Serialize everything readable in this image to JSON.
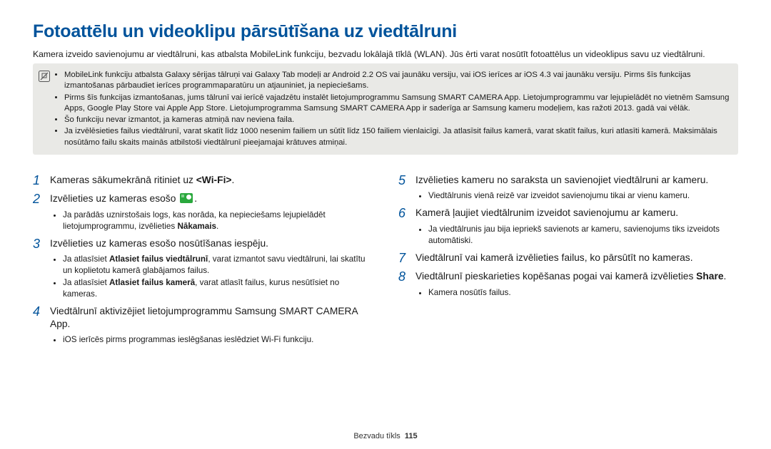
{
  "title": "Fotoattēlu un videoklipu pārsūtīšana uz viedtālruni",
  "intro": "Kamera izveido savienojumu ar viedtālruni, kas atbalsta MobileLink funkciju, bezvadu lokālajā tīklā (WLAN). Jūs ērti varat nosūtīt fotoattēlus un videoklipus savu uz viedtālruni.",
  "note": {
    "b1": "MobileLink funkciju atbalsta Galaxy sērijas tālruņi vai Galaxy Tab modeļi ar Android 2.2 OS vai jaunāku versiju, vai iOS ierīces ar iOS 4.3 vai jaunāku versiju. Pirms šīs funkcijas izmantošanas pārbaudiet ierīces programmaparatūru un atjauniniet, ja nepieciešams.",
    "b2": "Pirms šīs funkcijas izmantošanas, jums tālrunī vai ierīcē vajadzētu instalēt lietojumprogrammu Samsung SMART CAMERA App. Lietojumprogrammu var lejupielādēt no vietnēm Samsung Apps, Google Play Store vai Apple App Store. Lietojumprogramma Samsung SMART CAMERA App ir saderīga ar Samsung kameru modeļiem, kas ražoti 2013. gadā vai vēlāk.",
    "b3": "Šo funkciju nevar izmantot, ja kameras atmiņā nav neviena faila.",
    "b4": "Ja izvēlēsieties failus viedtālrunī, varat skatīt līdz 1000 nesenim failiem un sūtīt līdz 150 failiem vienlaicīgi. Ja atlasīsit failus kamerā, varat skatīt failus, kuri atlasīti kamerā. Maksimālais nosūtāmo failu skaits mainās atbilstoši viedtālrunī pieejamajai krātuves atmiņai."
  },
  "steps": {
    "s1": {
      "n": "1",
      "t_a": "Kameras sākumekrānā ritiniet uz ",
      "t_b": "<Wi-Fi>",
      "t_c": "."
    },
    "s2": {
      "n": "2",
      "t": "Izvēlieties uz kameras esošo ",
      "t2": ".",
      "sub_a": "Ja parādās uznirstošais logs, kas norāda, ka nepieciešams lejupielādēt lietojumprogrammu, izvēlieties ",
      "sub_b": "Nākamais",
      "sub_c": "."
    },
    "s3": {
      "n": "3",
      "t": "Izvēlieties uz kameras esošo nosūtīšanas iespēju.",
      "sub1_a": "Ja atlasīsiet ",
      "sub1_b": "Atlasiet failus viedtālrunī",
      "sub1_c": ", varat izmantot savu viedtālruni, lai skatītu un koplietotu kamerā glabājamos failus.",
      "sub2_a": "Ja atlasīsiet ",
      "sub2_b": "Atlasiet failus kamerā",
      "sub2_c": ", varat atlasīt failus, kurus nesūtīsiet no kameras."
    },
    "s4": {
      "n": "4",
      "t": "Viedtālrunī aktivizējiet lietojumprogrammu Samsung SMART CAMERA App.",
      "sub": "iOS ierīcēs pirms programmas ieslēgšanas ieslēdziet Wi-Fi funkciju."
    },
    "s5": {
      "n": "5",
      "t": "Izvēlieties kameru no saraksta un savienojiet viedtālruni ar kameru.",
      "sub": "Viedtālrunis vienā reizē var izveidot savienojumu tikai ar vienu kameru."
    },
    "s6": {
      "n": "6",
      "t": "Kamerā ļaujiet viedtālrunim izveidot savienojumu ar kameru.",
      "sub": "Ja viedtālrunis jau bija iepriekš savienots ar kameru, savienojums tiks izveidots automātiski."
    },
    "s7": {
      "n": "7",
      "t": "Viedtālrunī vai kamerā izvēlieties failus, ko pārsūtīt no kameras."
    },
    "s8": {
      "n": "8",
      "t_a": "Viedtālrunī pieskarieties kopēšanas pogai vai kamerā izvēlieties ",
      "t_b": "Share",
      "t_c": ".",
      "sub": "Kamera nosūtīs failus."
    }
  },
  "footer": {
    "section": "Bezvadu tīkls",
    "page": "115"
  }
}
